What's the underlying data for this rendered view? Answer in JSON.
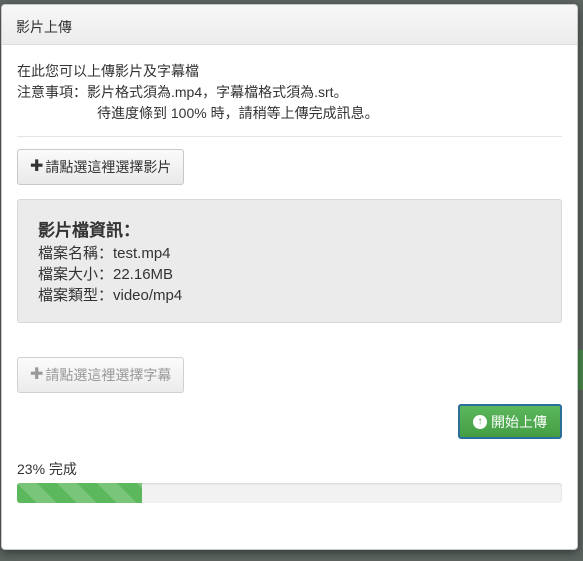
{
  "dialog": {
    "title": "影片上傳",
    "description": {
      "line1": "在此您可以上傳影片及字幕檔",
      "line2": "注意事項：影片格式須為.mp4，字幕檔格式須為.srt。",
      "line3": "待進度條到 100% 時，請稍等上傳完成訊息。"
    },
    "select_video_button": "請點選這裡選擇影片",
    "file_info": {
      "title": "影片檔資訊：",
      "name": "檔案名稱：test.mp4",
      "size": "檔案大小：22.16MB",
      "type": "檔案類型：video/mp4"
    },
    "select_subtitle_button": "請點選這裡選擇字幕",
    "upload_button": "開始上傳",
    "progress": {
      "label": "23% 完成",
      "percent": 23,
      "color": "#5cb85c"
    }
  }
}
